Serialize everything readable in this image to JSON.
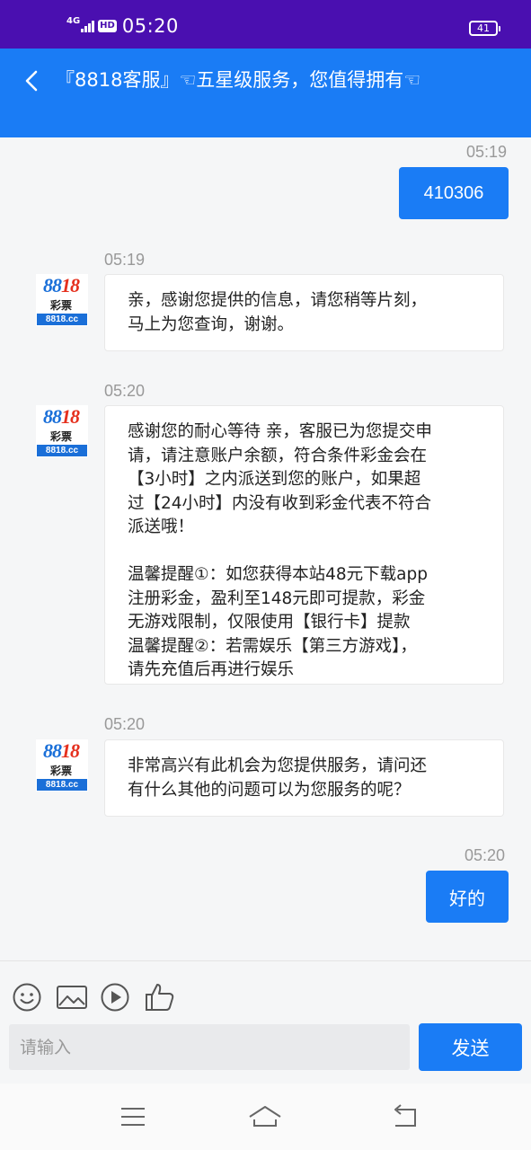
{
  "status_bar": {
    "network": "4G",
    "hd": "HD",
    "time": "05:20",
    "battery": "41"
  },
  "header": {
    "title": "『8818客服』☜五星级服务，您值得拥有☜"
  },
  "messages": [
    {
      "time": "05:19",
      "text": "410306"
    },
    {
      "time": "05:19",
      "text": "亲，感谢您提供的信息，请您稍等片刻，\n马上为您查询，谢谢。"
    },
    {
      "time": "05:20",
      "text": "感谢您的耐心等待 亲，客服已为您提交申\n请，请注意账户余额，符合条件彩金会在\n【3小时】之内派送到您的账户，如果超\n过【24小时】内没有收到彩金代表不符合\n派送哦！\n\n温馨提醒①：如您获得本站48元下载app\n注册彩金，盈利至148元即可提款，彩金\n无游戏限制，仅限使用【银行卡】提款\n温馨提醒②：若需娱乐【第三方游戏】，\n请先充值后再进行娱乐"
    },
    {
      "time": "05:20",
      "text": "非常高兴有此机会为您提供服务，请问还\n有什么其他的问题可以为您服务的呢？"
    },
    {
      "time": "05:20",
      "text": "好的"
    }
  ],
  "avatar": {
    "num_a": "88",
    "num_b": "18",
    "cn": "彩票",
    "url": "8818.cc"
  },
  "input": {
    "placeholder": "请输入",
    "send_label": "发送"
  },
  "colors": {
    "status_bar": "#4a0fb0",
    "accent": "#1a7cf5"
  },
  "icons": [
    "emoji-icon",
    "image-icon",
    "video-icon",
    "thumbs-up-icon",
    "menu-icon",
    "home-icon",
    "back-nav-icon"
  ]
}
